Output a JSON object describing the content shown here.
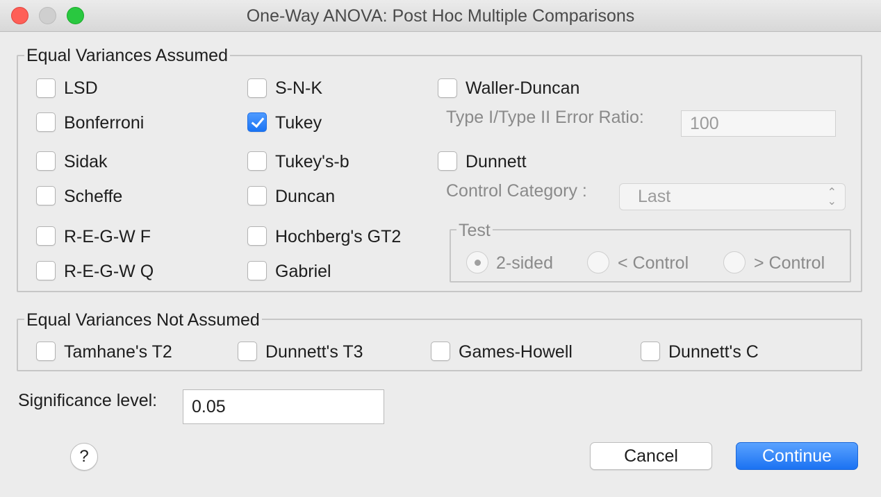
{
  "window": {
    "title": "One-Way ANOVA: Post Hoc Multiple Comparisons"
  },
  "equal_assumed": {
    "legend": "Equal Variances Assumed",
    "options": {
      "lsd": {
        "label": "LSD",
        "checked": false
      },
      "snk": {
        "label": "S-N-K",
        "checked": false
      },
      "waller": {
        "label": "Waller-Duncan",
        "checked": false
      },
      "bonferroni": {
        "label": "Bonferroni",
        "checked": false
      },
      "tukey": {
        "label": "Tukey",
        "checked": true
      },
      "sidak": {
        "label": "Sidak",
        "checked": false
      },
      "tukeyb": {
        "label": "Tukey's-b",
        "checked": false
      },
      "dunnett": {
        "label": "Dunnett",
        "checked": false
      },
      "scheffe": {
        "label": "Scheffe",
        "checked": false
      },
      "duncan": {
        "label": "Duncan",
        "checked": false
      },
      "regwf": {
        "label": "R-E-G-W F",
        "checked": false
      },
      "hochberg": {
        "label": "Hochberg's GT2",
        "checked": false
      },
      "regwq": {
        "label": "R-E-G-W Q",
        "checked": false
      },
      "gabriel": {
        "label": "Gabriel",
        "checked": false
      }
    },
    "error_ratio": {
      "label": "Type I/Type II Error Ratio:",
      "value": "100"
    },
    "control_category": {
      "label": "Control Category :",
      "value": "Last"
    },
    "test": {
      "legend": "Test",
      "two_sided": "2-sided",
      "lt_control": "< Control",
      "gt_control": "> Control"
    }
  },
  "equal_not_assumed": {
    "legend": "Equal Variances Not Assumed",
    "options": {
      "tamhane": {
        "label": "Tamhane's T2",
        "checked": false
      },
      "dunnett_t3": {
        "label": "Dunnett's T3",
        "checked": false
      },
      "games_howell": {
        "label": "Games-Howell",
        "checked": false
      },
      "dunnett_c": {
        "label": "Dunnett's C",
        "checked": false
      }
    }
  },
  "significance": {
    "label": "Significance level:",
    "value": "0.05"
  },
  "buttons": {
    "help": "?",
    "cancel": "Cancel",
    "continue": "Continue"
  }
}
